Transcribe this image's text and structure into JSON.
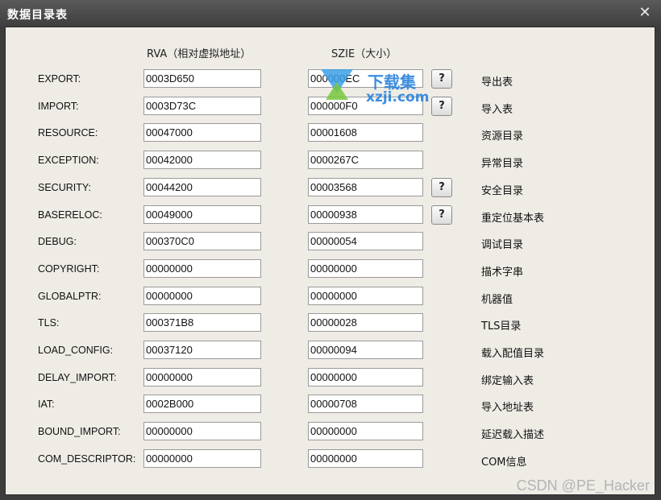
{
  "window": {
    "title": "数据目录表",
    "close_glyph": "✕"
  },
  "headers": {
    "rva": "RVA（相对虚拟地址）",
    "size": "SZIE（大小）"
  },
  "entries": [
    {
      "label": "EXPORT:",
      "rva": "0003D650",
      "size": "000000EC",
      "help": "?",
      "desc": "导出表"
    },
    {
      "label": "IMPORT:",
      "rva": "0003D73C",
      "size": "000000F0",
      "help": "?",
      "desc": "导入表"
    },
    {
      "label": "RESOURCE:",
      "rva": "00047000",
      "size": "00001608",
      "desc": "资源目录"
    },
    {
      "label": "EXCEPTION:",
      "rva": "00042000",
      "size": "0000267C",
      "desc": "异常目录"
    },
    {
      "label": "SECURITY:",
      "rva": "00044200",
      "size": "00003568",
      "help": "?",
      "desc": "安全目录"
    },
    {
      "label": "BASERELOC:",
      "rva": "00049000",
      "size": "00000938",
      "help": "?",
      "desc": "重定位基本表"
    },
    {
      "label": "DEBUG:",
      "rva": "000370C0",
      "size": "00000054",
      "desc": "调试目录"
    },
    {
      "label": "COPYRIGHT:",
      "rva": "00000000",
      "size": "00000000",
      "desc": "描术字串"
    },
    {
      "label": "GLOBALPTR:",
      "rva": "00000000",
      "size": "00000000",
      "desc": "机器值"
    },
    {
      "label": "TLS:",
      "rva": "000371B8",
      "size": "00000028",
      "desc": "TLS目录"
    },
    {
      "label": "LOAD_CONFIG:",
      "rva": "00037120",
      "size": "00000094",
      "desc": "载入配值目录"
    },
    {
      "label": "DELAY_IMPORT:",
      "rva": "00000000",
      "size": "00000000",
      "desc": "绑定输入表"
    },
    {
      "label": "IAT:",
      "rva": "0002B000",
      "size": "00000708",
      "desc": "导入地址表"
    },
    {
      "label": "BOUND_IMPORT:",
      "rva": "00000000",
      "size": "00000000",
      "desc": "延迟载入描述"
    },
    {
      "label": "COM_DESCRIPTOR:",
      "rva": "00000000",
      "size": "00000000",
      "desc": "COM信息"
    }
  ],
  "watermarks": {
    "site_cn": "下载集",
    "site_url": "xzji.com",
    "csdn": "CSDN @PE_Hacker"
  }
}
